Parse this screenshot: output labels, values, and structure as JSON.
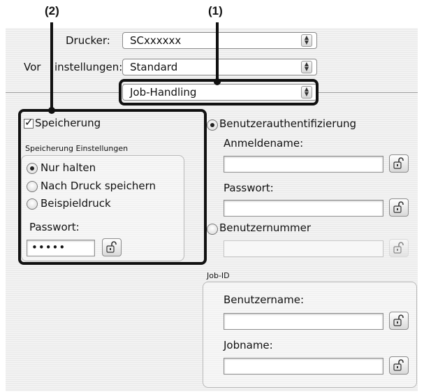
{
  "callouts": {
    "one": "(1)",
    "two": "(2)"
  },
  "printer": {
    "label": "Drucker:",
    "value": "SCxxxxxx"
  },
  "presets": {
    "label_start": "Vor",
    "label_end": "instellungen:",
    "value": "Standard"
  },
  "section_menu": {
    "value": "Job-Handling"
  },
  "storage": {
    "checkbox_label": "Speicherung",
    "settings_title": "Speicherung Einstellungen",
    "options": [
      "Nur halten",
      "Nach Druck speichern",
      "Beispieldruck"
    ],
    "selected": "Nur halten",
    "password_label": "Passwort:",
    "password_value": "•••••"
  },
  "auth": {
    "user_auth_label": "Benutzerauthentifizierung",
    "login_label": "Anmeldename:",
    "password_label": "Passwort:",
    "user_number_label": "Benutzernummer"
  },
  "job_id": {
    "title": "Job-ID",
    "username_label": "Benutzername:",
    "jobname_label": "Jobname:"
  },
  "icons": {
    "lock": "unlock-icon",
    "popup_arrows": "updown-arrows-icon"
  }
}
